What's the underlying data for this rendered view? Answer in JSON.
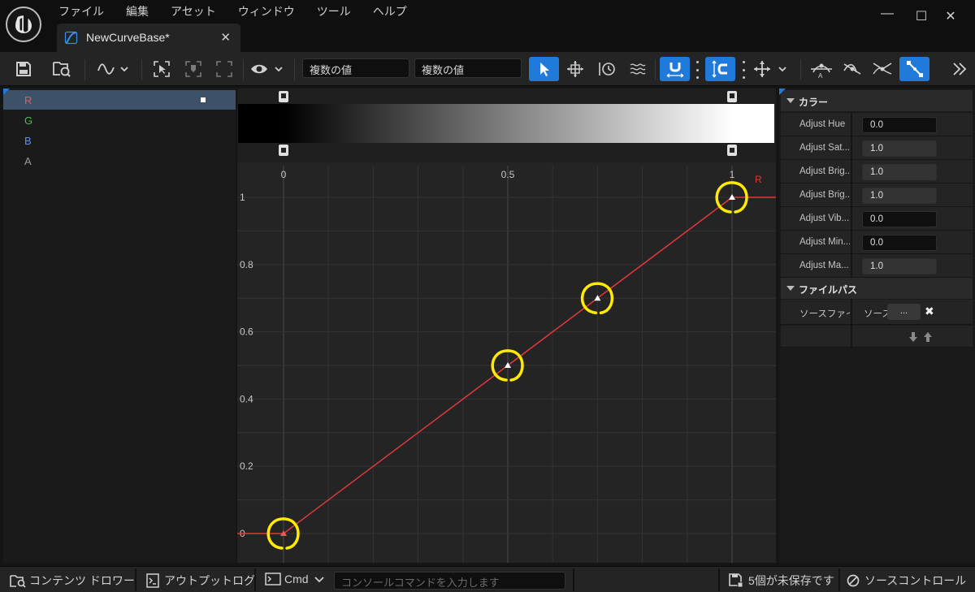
{
  "menu": [
    "ファイル",
    "編集",
    "アセット",
    "ウィンドウ",
    "ツール",
    "ヘルプ"
  ],
  "tab": {
    "title": "NewCurveBase*",
    "close": "✕"
  },
  "window_controls": {
    "minimize": "—",
    "maximize": "☐",
    "close": "✕"
  },
  "toolbar": {
    "field1": "複数の値",
    "field2": "複数の値",
    "accent_color": "#1f7ad9"
  },
  "channels": [
    {
      "label": "R",
      "color": "#e85a5a"
    },
    {
      "label": "G",
      "color": "#4ebd4e"
    },
    {
      "label": "B",
      "color": "#5d8ff0"
    },
    {
      "label": "A",
      "color": "#9a9a9a"
    }
  ],
  "graph": {
    "x_ticks": [
      "0",
      "0.5",
      "1"
    ],
    "y_ticks": [
      "1",
      "0.8",
      "0.6",
      "0.4",
      "0.2",
      "0"
    ],
    "curve_label": "R",
    "curve_color": "#e0393b",
    "highlight_color": "#ffea00"
  },
  "chart_data": {
    "type": "line",
    "series": [
      {
        "name": "R",
        "x": [
          0,
          0.5,
          0.7,
          1
        ],
        "y": [
          0,
          0.5,
          0.7,
          1
        ]
      }
    ],
    "xlim": [
      -0.1,
      1.09
    ],
    "ylim": [
      -0.07,
      1.1
    ],
    "gradient": {
      "from": "#000000",
      "to": "#ffffff",
      "x_start": 0,
      "x_end": 1
    }
  },
  "details": {
    "sections": [
      {
        "title": "カラー",
        "rows": [
          {
            "label": "Adjust Hue",
            "value": "0.0",
            "style": "dark"
          },
          {
            "label": "Adjust Sat...",
            "value": "1.0",
            "style": "gray"
          },
          {
            "label": "Adjust Brig...",
            "value": "1.0",
            "style": "gray"
          },
          {
            "label": "Adjust Brig...",
            "value": "1.0",
            "style": "gray"
          },
          {
            "label": "Adjust Vib...",
            "value": "0.0",
            "style": "dark"
          },
          {
            "label": "Adjust Min...",
            "value": "0.0",
            "style": "dark"
          },
          {
            "label": "Adjust Ma...",
            "value": "1.0",
            "style": "gray"
          }
        ]
      },
      {
        "title": "ファイルパス",
        "source_label": "ソースファイル",
        "source_value": "ソース",
        "browse": "...",
        "clear": "✖"
      }
    ]
  },
  "statusbar": {
    "content_drawer": "コンテンツ ドロワー",
    "output_log": "アウトプットログ",
    "cmd": "Cmd",
    "cmd_placeholder": "コンソールコマンドを入力します",
    "unsaved": "5個が未保存です",
    "source_control": "ソースコントロール"
  }
}
